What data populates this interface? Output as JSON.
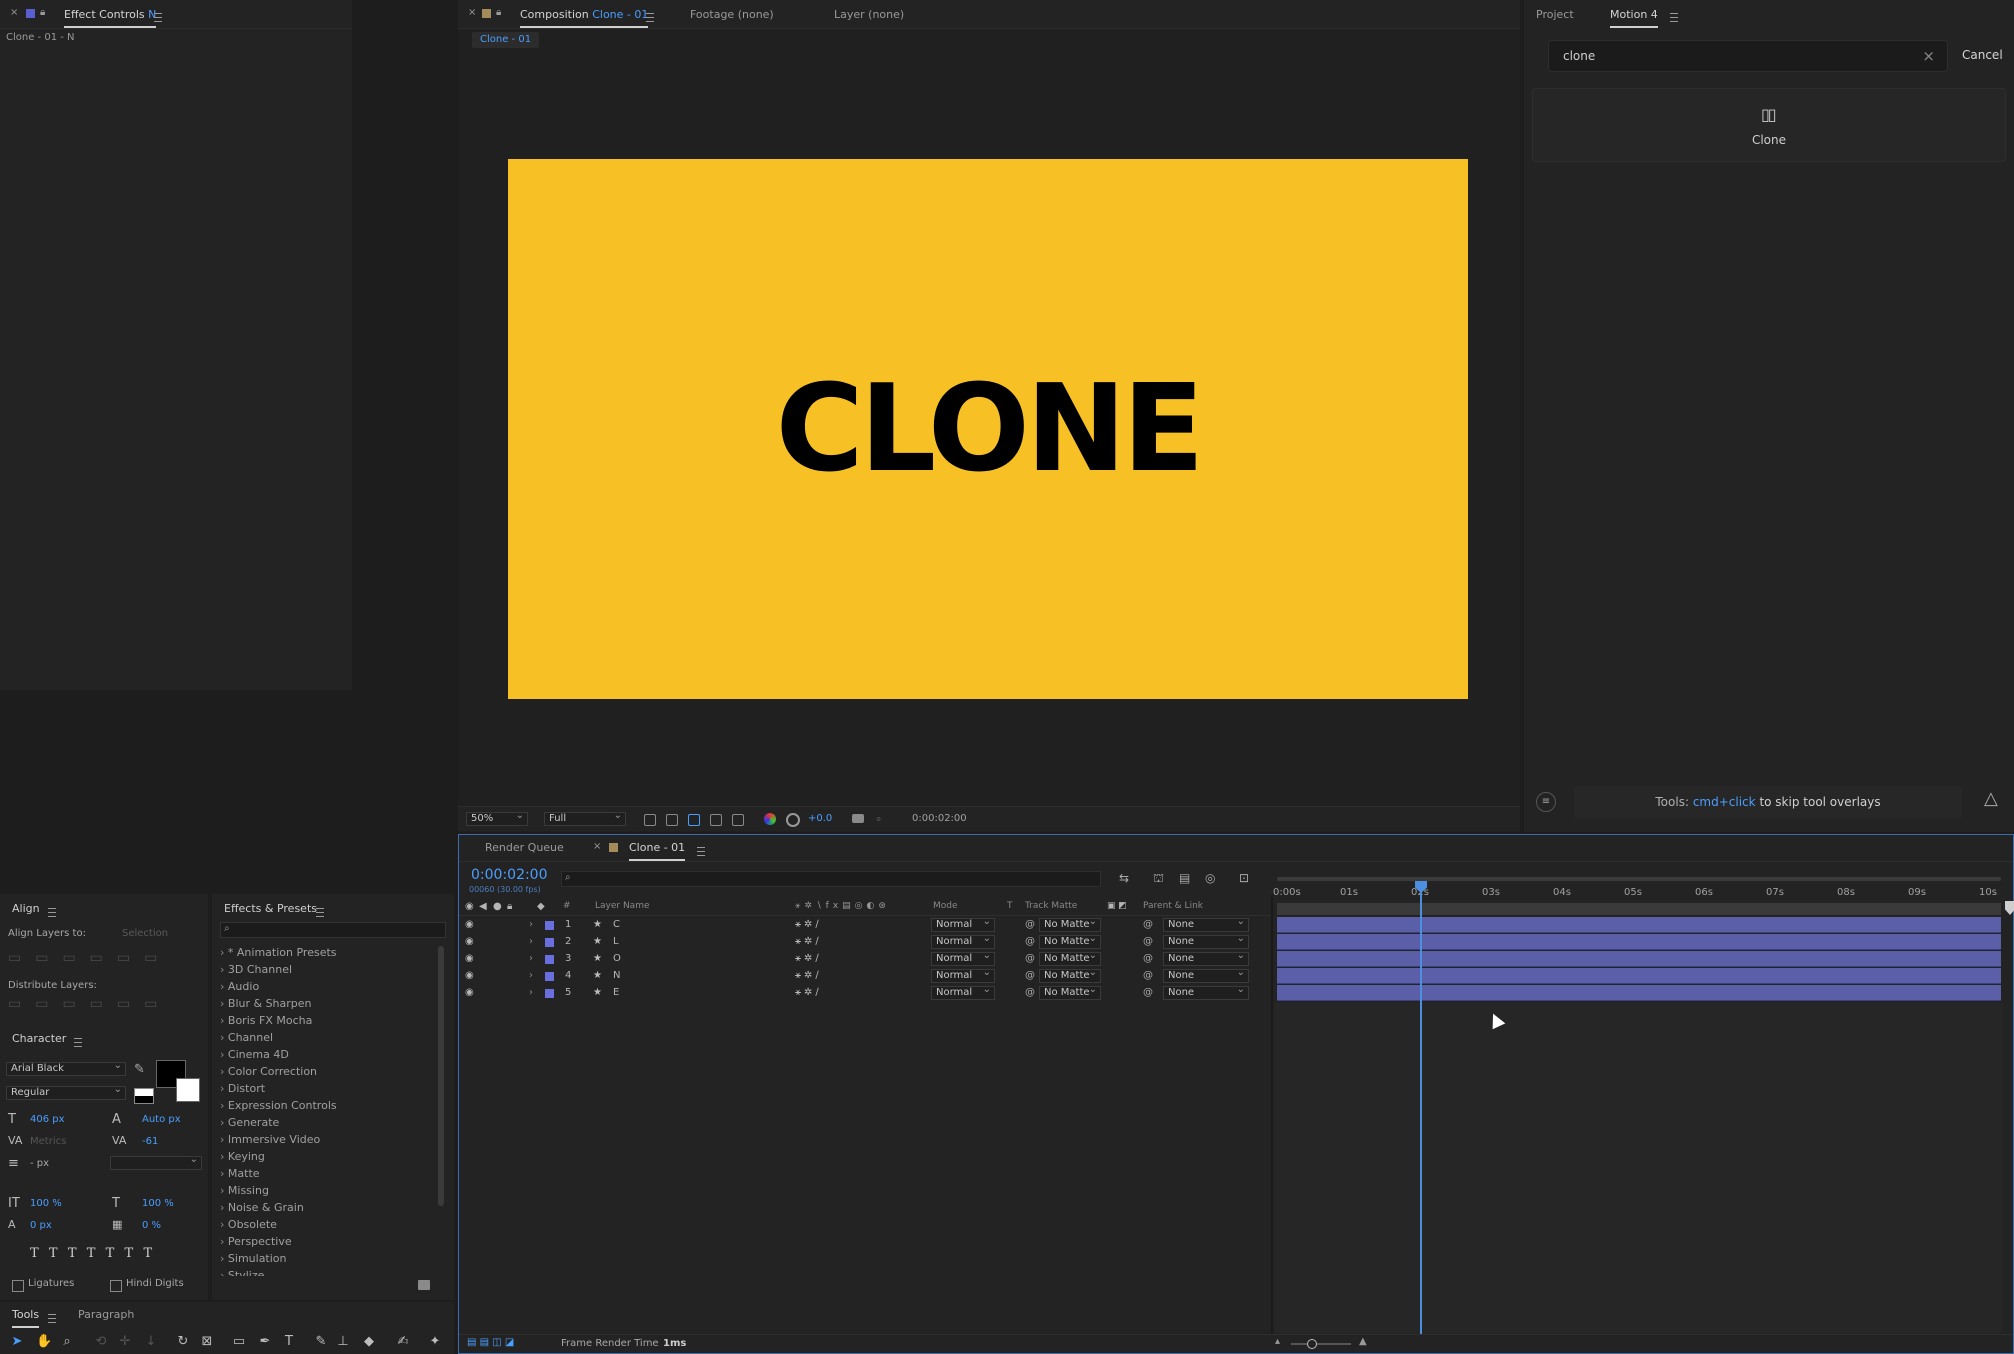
{
  "effect_controls": {
    "tab_label": "Effect Controls",
    "tab_layer": "N",
    "subtitle": "Clone - 01 - N"
  },
  "composition": {
    "tab_prefix": "Composition",
    "tab_name": "Clone - 01",
    "footage_tab": "Footage (none)",
    "layer_tab": "Layer (none)",
    "breadcrumb": "Clone - 01",
    "canvas_text": "CLONE",
    "canvas_color": "#f7c024",
    "zoom": "50%",
    "resolution": "Full",
    "exposure": "+0.0",
    "timecode": "0:00:02:00"
  },
  "motion": {
    "tab_project": "Project",
    "tab_motion": "Motion 4",
    "search_value": "clone",
    "cancel_label": "Cancel",
    "result_label": "Clone",
    "tip_prefix": "Tools:",
    "tip_highlight": "cmd+click",
    "tip_suffix": "to skip tool overlays"
  },
  "align": {
    "title": "Align",
    "align_to_label": "Align Layers to:",
    "align_to_value": "Selection",
    "distribute_label": "Distribute Layers:"
  },
  "character": {
    "title": "Character",
    "font": "Arial Black",
    "style": "Regular",
    "size": "406 px",
    "leading": "Auto px",
    "kerning": "Metrics",
    "tracking": "-61",
    "stroke": "- px",
    "vscale": "100 %",
    "hscale": "100 %",
    "baseline": "0 px",
    "tsume": "0 %",
    "ligatures": "Ligatures",
    "hindi_digits": "Hindi Digits"
  },
  "effects": {
    "title": "Effects & Presets",
    "items": [
      "* Animation Presets",
      "3D Channel",
      "Audio",
      "Blur & Sharpen",
      "Boris FX Mocha",
      "Channel",
      "Cinema 4D",
      "Color Correction",
      "Distort",
      "Expression Controls",
      "Generate",
      "Immersive Video",
      "Keying",
      "Matte",
      "Missing",
      "Noise & Grain",
      "Obsolete",
      "Perspective",
      "Simulation",
      "Stylize"
    ]
  },
  "tools": {
    "tab_tools": "Tools",
    "tab_paragraph": "Paragraph"
  },
  "timeline": {
    "tab_render": "Render Queue",
    "tab_comp": "Clone - 01",
    "timecode": "0:00:02:00",
    "frames": "00060 (30.00 fps)",
    "col_num": "#",
    "col_name": "Layer Name",
    "col_mode": "Mode",
    "col_t": "T",
    "col_matte": "Track Matte",
    "col_parent": "Parent & Link",
    "layers": [
      {
        "num": "1",
        "name": "C",
        "mode": "Normal",
        "matte": "No Matte",
        "parent": "None"
      },
      {
        "num": "2",
        "name": "L",
        "mode": "Normal",
        "matte": "No Matte",
        "parent": "None"
      },
      {
        "num": "3",
        "name": "O",
        "mode": "Normal",
        "matte": "No Matte",
        "parent": "None"
      },
      {
        "num": "4",
        "name": "N",
        "mode": "Normal",
        "matte": "No Matte",
        "parent": "None"
      },
      {
        "num": "5",
        "name": "E",
        "mode": "Normal",
        "matte": "No Matte",
        "parent": "None"
      }
    ],
    "ticks": [
      "0:00s",
      "01s",
      "02s",
      "03s",
      "04s",
      "05s",
      "06s",
      "07s",
      "08s",
      "09s",
      "10s"
    ],
    "render_time_label": "Frame Render Time",
    "render_time_value": "1ms",
    "layer_color": "#5a5fa8"
  }
}
